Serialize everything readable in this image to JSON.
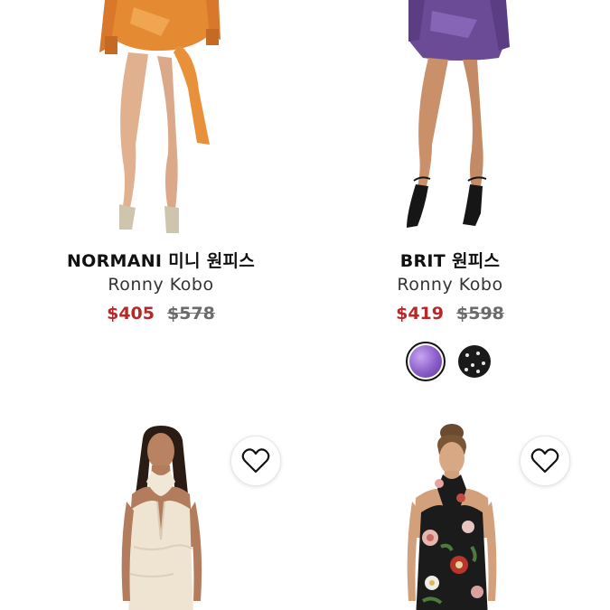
{
  "products": [
    {
      "title": "NORMANI 미니 원피스",
      "brand": "Ronny Kobo",
      "sale_price": "$405",
      "original_price": "$578"
    },
    {
      "title": "BRIT 원피스",
      "brand": "Ronny Kobo",
      "sale_price": "$419",
      "original_price": "$598",
      "swatches": [
        {
          "name": "purple-sequin",
          "color": "#8a5cc9",
          "selected": true
        },
        {
          "name": "black-dot",
          "color": "#1a1a1a",
          "selected": false
        }
      ]
    },
    {
      "icon": "heart-icon"
    },
    {
      "icon": "heart-icon"
    }
  ],
  "colors": {
    "sale": "#b42a2a",
    "original": "#6b6b6b"
  }
}
